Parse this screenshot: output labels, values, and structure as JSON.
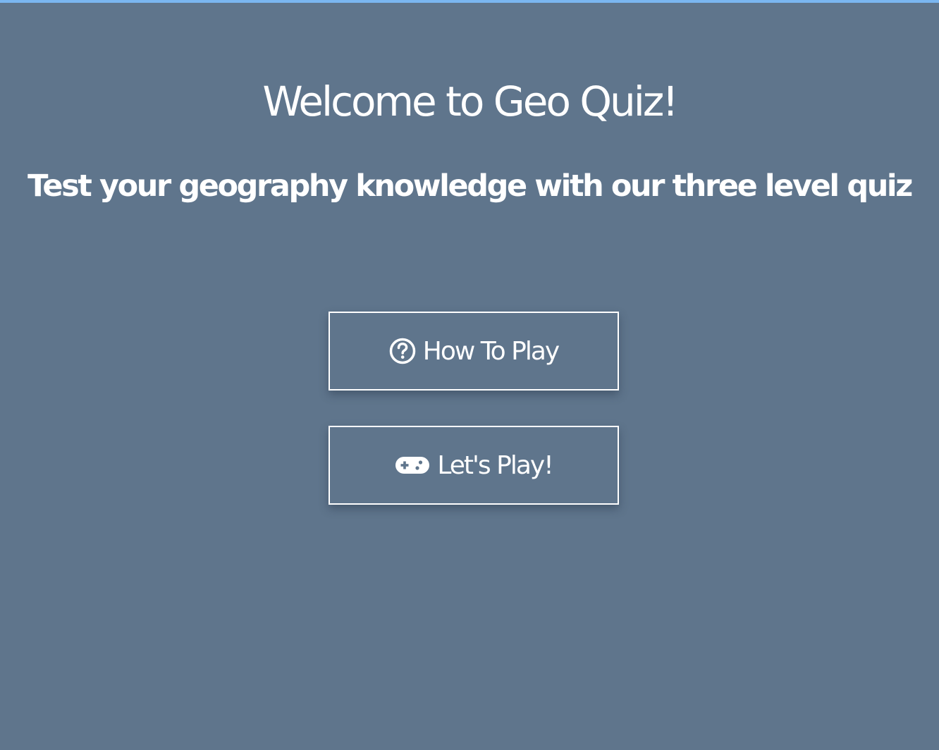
{
  "header": {
    "title": "Welcome to Geo Quiz!",
    "subtitle": "Test your geography knowledge with our three level quiz"
  },
  "buttons": {
    "how_to_play": {
      "label": "How To Play",
      "icon": "question-circle-icon"
    },
    "lets_play": {
      "label": "Let's Play!",
      "icon": "gamepad-icon"
    }
  },
  "colors": {
    "background": "#5f758c",
    "text": "#ffffff",
    "top_strip": "#7ab6f0"
  }
}
